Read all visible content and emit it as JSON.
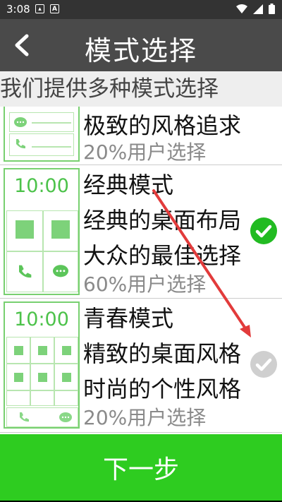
{
  "status": {
    "time": "3:08"
  },
  "header": {
    "title": "模式选择"
  },
  "subheader": {
    "text": "我们提供多种模式选择"
  },
  "modes": [
    {
      "line1": "极致的风格追求",
      "usage": "20%用户选择",
      "checked": false
    },
    {
      "name": "经典模式",
      "line1": "经典的桌面布局",
      "line2": "大众的最佳选择",
      "usage": "60%用户选择",
      "preview_time": "10:00",
      "checked": true
    },
    {
      "name": "青春模式",
      "line1": "精致的桌面风格",
      "line2": "时尚的个性风格",
      "usage": "20%用户选择",
      "preview_time": "10:00",
      "checked": false
    }
  ],
  "footer": {
    "next_label": "下一步"
  },
  "colors": {
    "accent_green": "#2ecc20",
    "check_green": "#22bb22",
    "check_gray": "#cfcfcf",
    "annotation_red": "#e23b3b"
  }
}
